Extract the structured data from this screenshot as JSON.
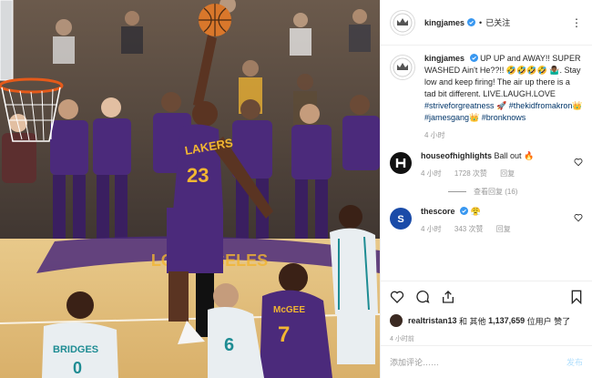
{
  "header": {
    "username": "kingjames",
    "follow_status": "已关注",
    "more_icon": "more-icon"
  },
  "caption": {
    "username": "kingjames",
    "text": "UP UP and AWAY!! SUPER WASHED Ain't He??!! 🤣🤣🤣🤣 🤷🏾‍♂️. Stay low and keep firing! The air up there is a tad bit different. LIVE.LAUGH.LOVE",
    "hashtags": [
      "#striveforgreatness",
      "🚀",
      "#thekidfromakron👑",
      "#jamesgang👑",
      "#bronknows"
    ],
    "time": "4 小时"
  },
  "comments": [
    {
      "username": "houseofhighlights",
      "text": "Ball out 🔥",
      "time": "4 小时",
      "likes": "1728 次赞",
      "reply": "回复",
      "view_replies": "查看回复 (16)"
    },
    {
      "username": "thescore",
      "text": "😤",
      "time": "4 小时",
      "likes": "343 次赞",
      "reply": "回复"
    }
  ],
  "likes_line": {
    "user": "realtristan13",
    "and": "和 其他",
    "count": "1,137,659",
    "suffix": "位用户 赞了"
  },
  "post_time": "4 小时前",
  "add_comment": {
    "placeholder": "添加评论……",
    "post_label": "发布"
  },
  "photo": {
    "jersey_player1": "LAKERS",
    "jersey_player1_number": "23",
    "jersey_player2_name": "McGEE",
    "jersey_player2_number": "7",
    "jersey_player3_name": "BRIDGES",
    "jersey_player3_number": "0",
    "jersey_player4_number": "6"
  },
  "colors": {
    "lakers_purple": "#4b2a7b",
    "lakers_gold": "#f2b632",
    "hornets_white": "#e9eef1",
    "hornets_teal": "#1e8c93",
    "link": "#003569",
    "muted": "#999999"
  }
}
